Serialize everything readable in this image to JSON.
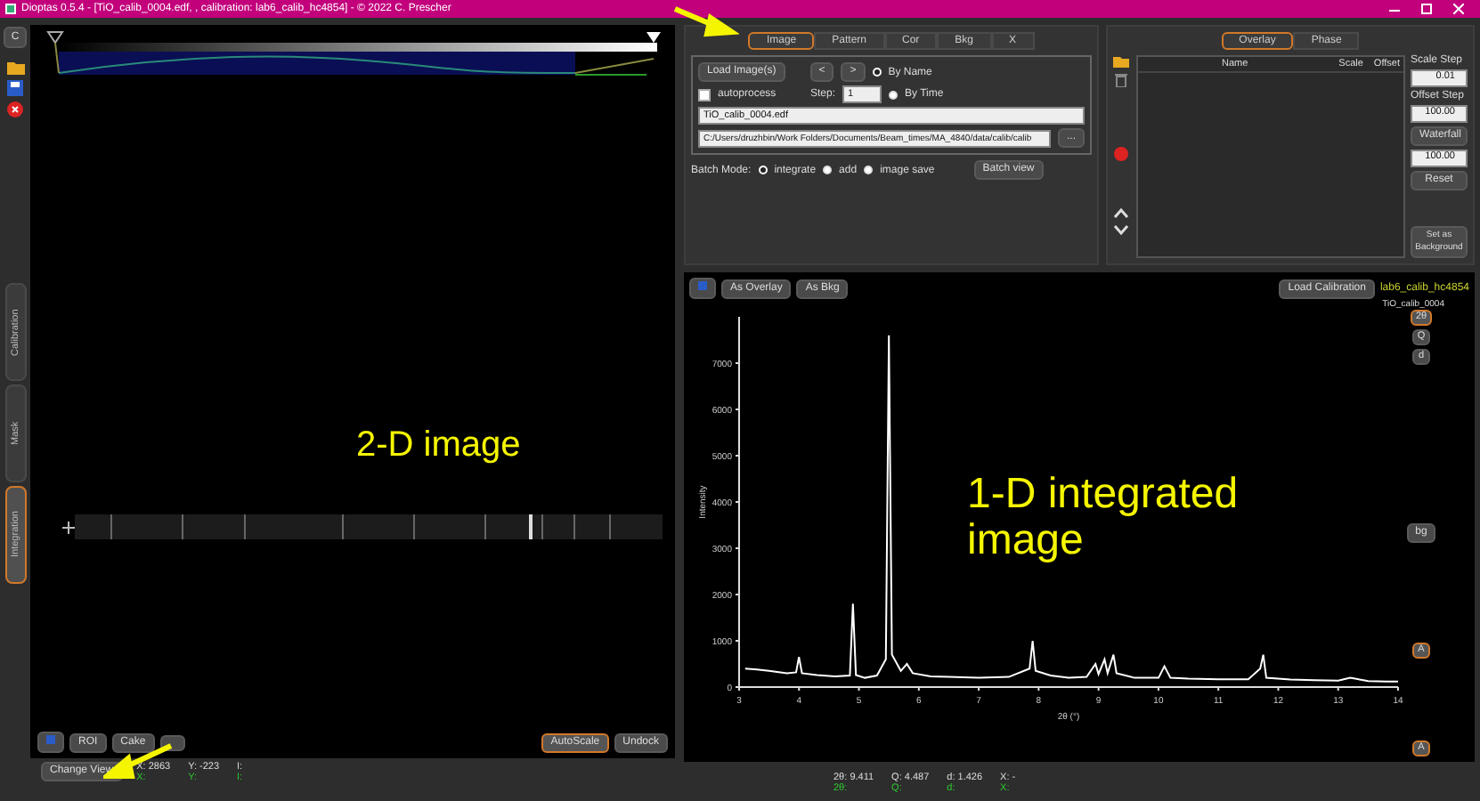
{
  "window": {
    "title": "Dioptas 0.5.4 - [TiO_calib_0004.edf, , calibration: lab6_calib_hc4854] - © 2022 C. Prescher"
  },
  "side_toolbar": {
    "button": "C"
  },
  "side_tabs": [
    {
      "label": "Calibration",
      "selected": false
    },
    {
      "label": "Mask",
      "selected": false
    },
    {
      "label": "Integration",
      "selected": true
    }
  ],
  "image_view": {
    "toolbar": [
      {
        "kind": "save"
      },
      {
        "kind": "text",
        "label": "ROI"
      },
      {
        "kind": "text",
        "label": "Cake"
      },
      {
        "kind": "covered"
      }
    ],
    "right_buttons": [
      {
        "label": "AutoScale",
        "selected": true
      },
      {
        "label": "Undock",
        "selected": false
      }
    ]
  },
  "image_status": {
    "button": "Change View",
    "fields": [
      {
        "label": "X:",
        "value": "2863"
      },
      {
        "label": "Y:",
        "value": "-223"
      },
      {
        "label": "I:"
      }
    ],
    "green_labels": [
      "X:",
      "Y:",
      "I:"
    ]
  },
  "control_tabs": [
    {
      "label": "Image",
      "selected": true
    },
    {
      "label": "Pattern",
      "selected": false
    },
    {
      "label": "Cor",
      "selected": false
    },
    {
      "label": "Bkg",
      "selected": false
    },
    {
      "label": "X",
      "selected": false
    }
  ],
  "image_controls": {
    "load_button": "Load Image(s)",
    "prev": "<",
    "next": ">",
    "order_options": [
      {
        "label": "By Name",
        "selected": true
      },
      {
        "label": "By Time",
        "selected": false
      }
    ],
    "autoprocess": {
      "label": "autoprocess",
      "checked": false
    },
    "step_label": "Step:",
    "step": "1",
    "filename": "TiO_calib_0004.edf",
    "path": "C:/Users/druzhbin/Work Folders/Documents/Beam_times/MA_4840/data/calib/calib",
    "browse": "...",
    "batch_label": "Batch Mode:",
    "batch_modes": [
      {
        "label": "integrate",
        "selected": true
      },
      {
        "label": "add",
        "selected": false
      },
      {
        "label": "image save",
        "selected": false
      }
    ],
    "batch_view": "Batch view"
  },
  "overlay_tabs": [
    {
      "label": "Overlay",
      "selected": true
    },
    {
      "label": "Phase",
      "selected": false
    }
  ],
  "overlay_table": {
    "columns": [
      "Name",
      "Scale",
      "Offset"
    ]
  },
  "overlay_settings": {
    "scale_step_label": "Scale Step",
    "scale_step": "0.01",
    "offset_step_label": "Offset Step",
    "offset_step": "100.00",
    "waterfall": "Waterfall",
    "waterfall_value": "100.00",
    "reset": "Reset",
    "set_background": "Set as Background"
  },
  "pattern_view": {
    "buttons": [
      "As Overlay",
      "As Bkg"
    ],
    "load_calibration": "Load Calibration",
    "calibration_name": "lab6_calib_hc4854",
    "unit_buttons": [
      {
        "label": "2θ",
        "selected": true
      },
      {
        "label": "Q",
        "selected": false
      },
      {
        "label": "d",
        "selected": false
      }
    ],
    "bg_button": "bg",
    "auto_buttons": [
      "A",
      "A"
    ],
    "chart_data": {
      "type": "line",
      "xlabel": "2θ (°)",
      "ylabel": "Intensity",
      "x": [
        3.1,
        3.3,
        3.5,
        3.8,
        3.95,
        4.0,
        4.05,
        4.3,
        4.6,
        4.85,
        4.9,
        4.95,
        5.1,
        5.3,
        5.45,
        5.5,
        5.55,
        5.7,
        5.8,
        5.9,
        6.2,
        6.5,
        7.0,
        7.5,
        7.85,
        7.9,
        7.95,
        8.2,
        8.5,
        8.8,
        8.95,
        9.0,
        9.1,
        9.15,
        9.25,
        9.3,
        9.6,
        10.0,
        10.1,
        10.2,
        10.5,
        11.0,
        11.5,
        11.7,
        11.75,
        11.8,
        12.2,
        12.6,
        13.0,
        13.2,
        13.5,
        13.8,
        14.0
      ],
      "series": [
        {
          "name": "TiO_calib_0004",
          "color": "#ffffff",
          "values": [
            400,
            380,
            350,
            300,
            320,
            650,
            300,
            260,
            230,
            250,
            1800,
            260,
            200,
            250,
            600,
            7600,
            700,
            350,
            500,
            300,
            230,
            220,
            200,
            220,
            400,
            1000,
            350,
            250,
            200,
            220,
            500,
            280,
            600,
            300,
            700,
            300,
            200,
            200,
            450,
            200,
            180,
            170,
            170,
            400,
            700,
            200,
            160,
            150,
            140,
            200,
            130,
            120,
            120
          ]
        }
      ],
      "xlim": [
        3,
        14
      ],
      "ylim": [
        0,
        8000
      ],
      "xticks": [
        3,
        4,
        5,
        6,
        7,
        8,
        9,
        10,
        11,
        12,
        13,
        14
      ],
      "yticks": [
        0,
        1000,
        2000,
        3000,
        4000,
        5000,
        6000,
        7000
      ]
    }
  },
  "pattern_status": {
    "fields": [
      {
        "label": "2θ:",
        "value": "9.411"
      },
      {
        "label": "Q:",
        "value": "4.487"
      },
      {
        "label": "d:",
        "value": "1.426"
      },
      {
        "label": "X:",
        "value": "-"
      }
    ],
    "green_labels": [
      "2θ:",
      "Q:",
      "d:",
      "X:"
    ]
  },
  "annotations": [
    {
      "text": "2-D image"
    },
    {
      "text": "1-D integrated image"
    }
  ]
}
